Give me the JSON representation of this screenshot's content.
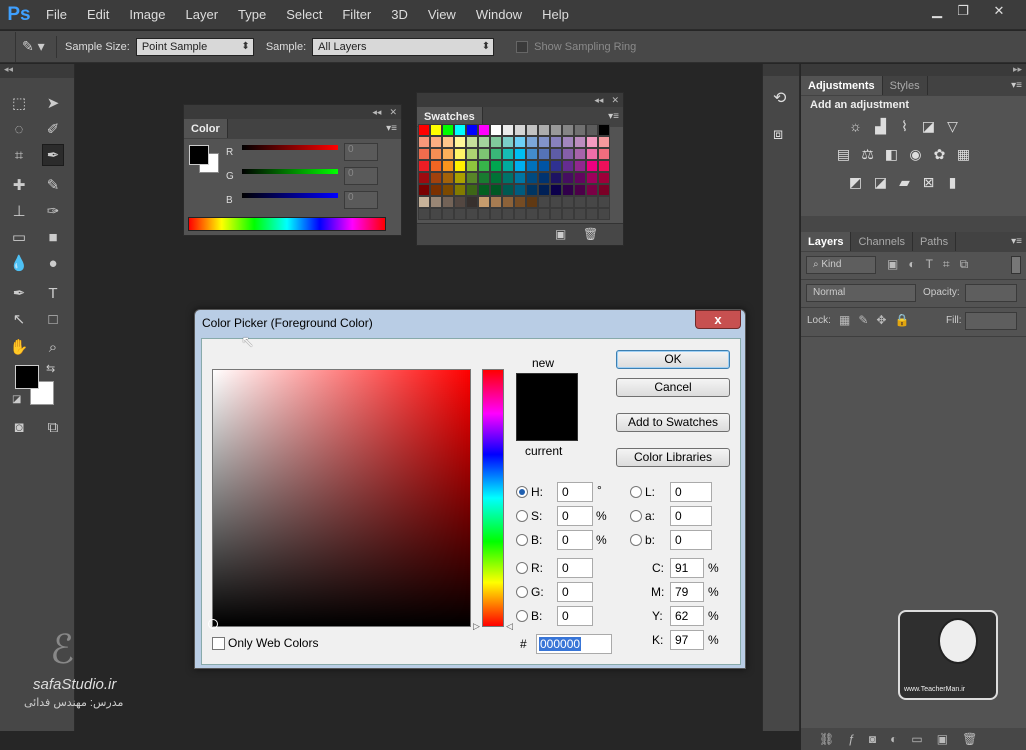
{
  "app": {
    "logo": "Ps"
  },
  "menu": [
    "File",
    "Edit",
    "Image",
    "Layer",
    "Type",
    "Select",
    "Filter",
    "3D",
    "View",
    "Window",
    "Help"
  ],
  "options": {
    "sample_size_label": "Sample Size:",
    "sample_size_value": "Point Sample",
    "sample_label": "Sample:",
    "sample_value": "All Layers",
    "show_ring_label": "Show Sampling Ring"
  },
  "color_panel": {
    "tab": "Color",
    "r_label": "R",
    "g_label": "G",
    "b_label": "B",
    "r_value": "0",
    "g_value": "0",
    "b_value": "0"
  },
  "swatches_panel": {
    "tab": "Swatches"
  },
  "adjustments": {
    "tabs": [
      "Adjustments",
      "Styles"
    ],
    "heading": "Add an adjustment"
  },
  "layers": {
    "tabs": [
      "Layers",
      "Channels",
      "Paths"
    ],
    "kind": "Kind",
    "blend_mode": "Normal",
    "opacity_label": "Opacity:",
    "lock_label": "Lock:",
    "fill_label": "Fill:"
  },
  "picker": {
    "title": "Color Picker (Foreground Color)",
    "close": "x",
    "new_label": "new",
    "current_label": "current",
    "ok": "OK",
    "cancel": "Cancel",
    "add_swatches": "Add to Swatches",
    "color_libraries": "Color Libraries",
    "only_web": "Only Web Colors",
    "H": {
      "label": "H:",
      "value": "0",
      "unit": "°"
    },
    "S": {
      "label": "S:",
      "value": "0",
      "unit": "%"
    },
    "B": {
      "label": "B:",
      "value": "0",
      "unit": "%"
    },
    "R": {
      "label": "R:",
      "value": "0"
    },
    "G": {
      "label": "G:",
      "value": "0"
    },
    "Bl": {
      "label": "B:",
      "value": "0"
    },
    "L": {
      "label": "L:",
      "value": "0"
    },
    "a": {
      "label": "a:",
      "value": "0"
    },
    "b": {
      "label": "b:",
      "value": "0"
    },
    "C": {
      "label": "C:",
      "value": "91",
      "unit": "%"
    },
    "M": {
      "label": "M:",
      "value": "79",
      "unit": "%"
    },
    "Y": {
      "label": "Y:",
      "value": "62",
      "unit": "%"
    },
    "K": {
      "label": "K:",
      "value": "97",
      "unit": "%"
    },
    "hash": "#",
    "hex": "000000"
  },
  "watermark": {
    "brand": "safaStudio.ir",
    "teacher": "مدرس: مهندس فدائی",
    "site": "www.TeacherMan.ir"
  },
  "colors": {
    "accent": "#3fa0ff",
    "selection": "#3875d7",
    "close_red": "#c75050"
  }
}
